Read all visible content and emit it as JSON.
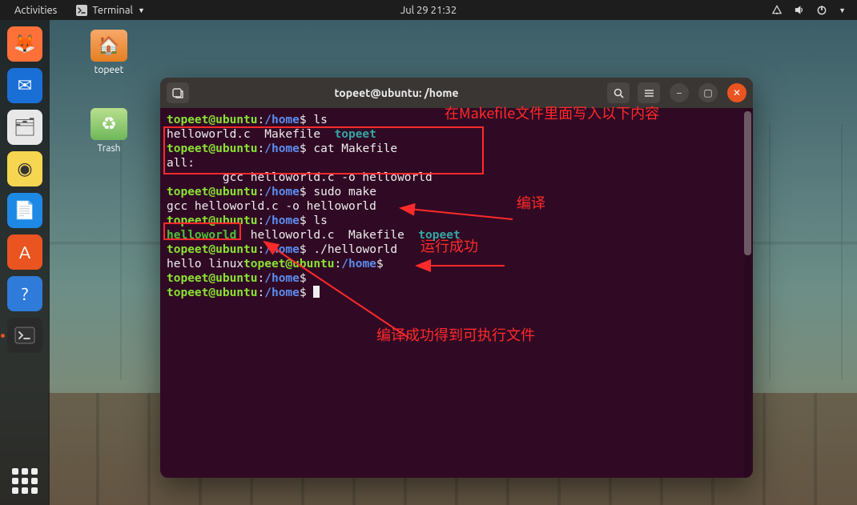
{
  "topbar": {
    "activities": "Activities",
    "app_menu": "Terminal",
    "clock": "Jul 29  21:32"
  },
  "desktop_icons": {
    "folder": "topeet",
    "trash": "Trash"
  },
  "dock": [
    {
      "name": "firefox",
      "bg": "#ff7139",
      "glyph": "🦊"
    },
    {
      "name": "thunderbird",
      "bg": "#1a6fd6",
      "glyph": "✉"
    },
    {
      "name": "files",
      "bg": "#e8e8e8",
      "glyph": "📁"
    },
    {
      "name": "rhythmbox",
      "bg": "#f6d650",
      "glyph": "◉"
    },
    {
      "name": "writer",
      "bg": "#1e88e5",
      "glyph": "📄"
    },
    {
      "name": "software",
      "bg": "#e95420",
      "glyph": "🛍"
    },
    {
      "name": "help",
      "bg": "#2f7bd9",
      "glyph": "?"
    },
    {
      "name": "terminal",
      "bg": "#2a2a2a",
      "glyph": ">_",
      "active": true
    }
  ],
  "terminal": {
    "title": "topeet@ubuntu: /home",
    "prompt_user": "topeet@ubuntu",
    "prompt_path": "/home",
    "prompt_sep": ":",
    "prompt_sym": "$",
    "lines": {
      "l1_cmd": "ls",
      "l2_out": "helloworld.c  Makefile  ",
      "l2_dir": "topeet",
      "l3_cmd": "cat Makefile",
      "l4": "all:",
      "l5": "        gcc helloworld.c -o helloworld",
      "l6_cmd": "sudo make",
      "l7": "gcc helloworld.c -o helloworld",
      "l8_cmd": "ls",
      "l9_exec": "helloworld",
      "l9_rest": "  helloworld.c  Makefile  ",
      "l9_dir": "topeet",
      "l10_cmd": "./helloworld",
      "l11_pre": "hello linux",
      "l12": "",
      "l13": ""
    }
  },
  "annotations": {
    "a1": "在Makefile文件里面写入以下内容",
    "a2": "编译",
    "a3": "运行成功",
    "a4": "编译成功得到可执行文件"
  },
  "colors": {
    "accent": "#e95420",
    "anno": "#ff2a2a"
  }
}
